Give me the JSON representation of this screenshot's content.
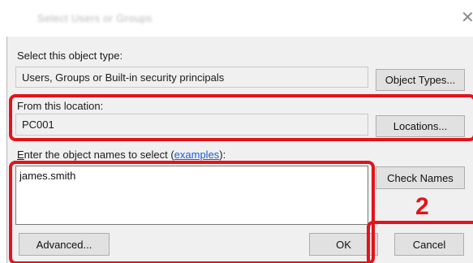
{
  "window": {
    "title": "Select Users or Groups"
  },
  "object_type": {
    "label": "Select this object type:",
    "value": "Users, Groups or Built-in security principals",
    "button": "Object Types..."
  },
  "location": {
    "label": "From this location:",
    "value": "PC001",
    "button": "Locations..."
  },
  "names": {
    "label_prefix_underlined": "E",
    "label_rest": "nter the object names to select (",
    "link": "examples",
    "label_suffix": "):",
    "value": "james.smith",
    "check_button": "Check Names"
  },
  "buttons": {
    "advanced": "Advanced...",
    "ok": "OK",
    "cancel": "Cancel"
  },
  "annotation": {
    "step_number": "2",
    "highlight_color": "#e3131b"
  }
}
